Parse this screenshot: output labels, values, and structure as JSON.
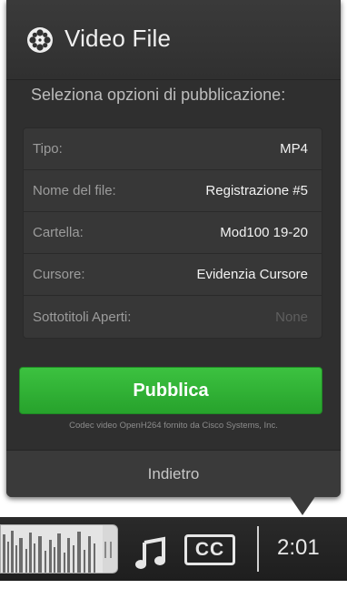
{
  "panel": {
    "title": "Video File",
    "subtitle": "Seleziona opzioni di pubblicazione:",
    "options": [
      {
        "label": "Tipo:",
        "value": "MP4"
      },
      {
        "label": "Nome del file:",
        "value": "Registrazione #5"
      },
      {
        "label": "Cartella:",
        "value": "Mod100 19-20"
      },
      {
        "label": "Cursore:",
        "value": "Evidenzia Cursore"
      },
      {
        "label": "Sottotitoli Aperti:",
        "value": "None"
      }
    ],
    "publish_label": "Pubblica",
    "codec_note": "Codec video OpenH264 fornito da Cisco Systems, Inc.",
    "back_label": "Indietro"
  },
  "controls": {
    "cc_label": "CC",
    "time": "2:01"
  },
  "colors": {
    "panel_bg": "#2f2f2f",
    "publish_green": "#2fb234",
    "text_light": "#f2f2f2"
  },
  "icons": [
    "film-reel-icon",
    "music-note-icon",
    "closed-captions-icon"
  ]
}
